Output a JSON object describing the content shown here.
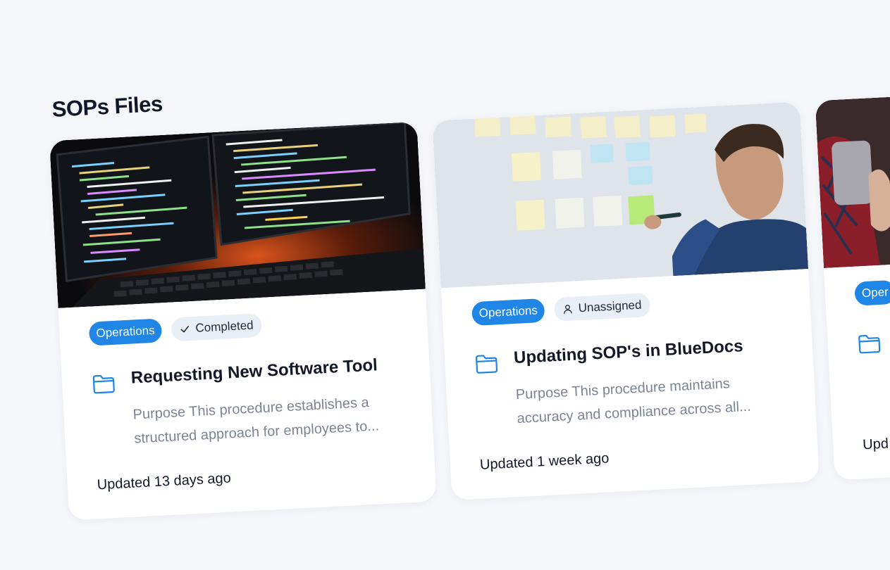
{
  "section": {
    "title": "SOPs Files"
  },
  "colors": {
    "accent": "#1f86e6",
    "background": "#f4f6fa",
    "status_bg": "#e9eff7"
  },
  "cards": [
    {
      "department": "Operations",
      "status": "Completed",
      "status_icon": "check-icon",
      "title": "Requesting New Software Tool",
      "description": "Purpose This procedure establishes a structured approach for employees to...",
      "updated": "Updated 13 days ago",
      "image": "computer-code-monitors"
    },
    {
      "department": "Operations",
      "status": "Unassigned",
      "status_icon": "user-icon",
      "title": "Updating SOP's in BlueDocs",
      "description": "Purpose This procedure maintains accuracy and compliance across all...",
      "updated": "Updated 1 week ago",
      "image": "man-writing-sticky-notes"
    },
    {
      "department": "Oper",
      "updated": "Upd",
      "image": "people-meeting"
    }
  ]
}
